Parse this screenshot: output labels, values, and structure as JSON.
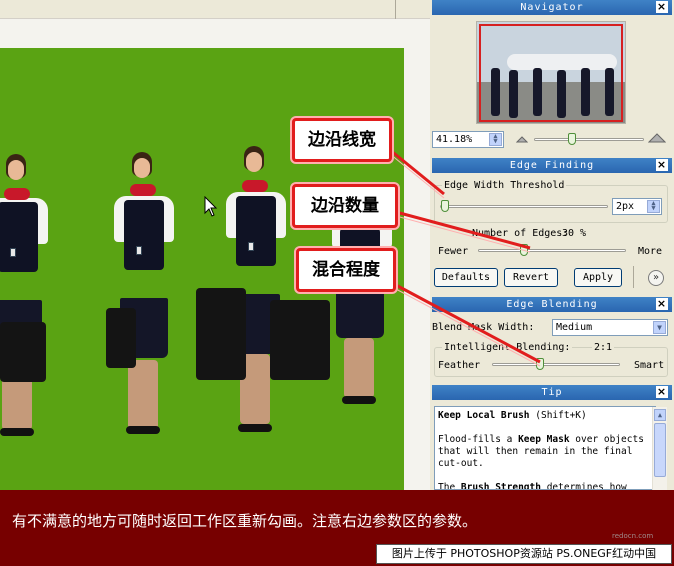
{
  "navigator": {
    "title": "Navigator",
    "zoom_value": "41.18%"
  },
  "edge_finding": {
    "title": "Edge Finding",
    "threshold_label": "Edge Width Threshold",
    "threshold_value": "2px",
    "threshold_level": 0.02,
    "edges_label": "Number of Edges:",
    "edges_value": "30 %",
    "edges_level": 0.3,
    "fewer_label": "Fewer",
    "more_label": "More",
    "defaults_label": "Defaults",
    "revert_label": "Revert",
    "apply_label": "Apply"
  },
  "edge_blending": {
    "title": "Edge Blending",
    "mask_width_label": "Blend Mask Width:",
    "mask_width_value": "Medium",
    "intelligent_label": "Intelligent Blending:",
    "intelligent_value": "2:1",
    "intelligent_level": 0.4,
    "feather_label": "Feather",
    "smart_label": "Smart"
  },
  "tip": {
    "title": "Tip",
    "heading_bold": "Keep Local Brush",
    "heading_shortcut": "(Shift+K)",
    "body1_pre": "Flood-fills a ",
    "body1_bold": "Keep Mask",
    "body1_post": " over objects that will then remain in the final cut-out.",
    "body2_pre": "The ",
    "body2_bold": "Brush Strength",
    "body2_post": " determines how"
  },
  "callouts": {
    "edge_width": "边沿线宽",
    "edge_count": "边沿数量",
    "blend_degree": "混合程度"
  },
  "banner": {
    "text": "有不满意的地方可随时返回工作区重新勾画。注意右边参数区的参数。",
    "credit": "图片上传于 PHOTOSHOP资源站  PS.ONEGF红动中国",
    "watermark": "redocn.com"
  },
  "colors": {
    "canvas_bg": "#5aa313",
    "title_bar": "#2a66b0",
    "callout_border": "#e11d1d",
    "banner_bg": "#770000"
  }
}
